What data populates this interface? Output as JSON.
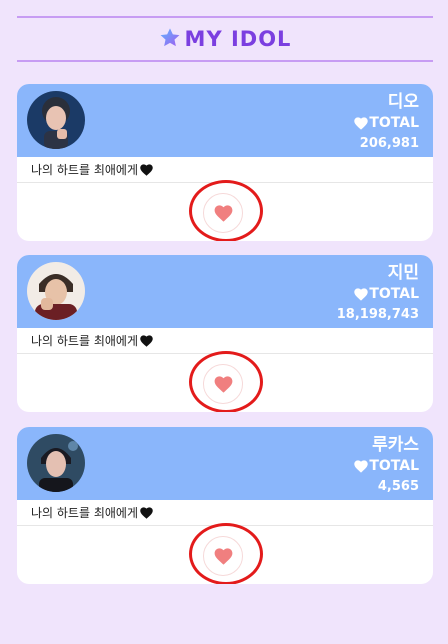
{
  "header": {
    "title": "MY IDOL",
    "star_icon": "star-icon"
  },
  "colors": {
    "background": "#f0e4fc",
    "header_line": "#c79cf3",
    "title": "#7b3fe0",
    "card_top": "#8ab6fb",
    "heart": "#f07f7f",
    "highlight_ring": "#e31b1b"
  },
  "cards": [
    {
      "name": "디오",
      "total_label": "TOTAL",
      "count": "206,981",
      "message": "나의 하트를 최애에게",
      "avatar_icon": "avatar-photo"
    },
    {
      "name": "지민",
      "total_label": "TOTAL",
      "count": "18,198,743",
      "message": "나의 하트를 최애에게",
      "avatar_icon": "avatar-photo"
    },
    {
      "name": "루카스",
      "total_label": "TOTAL",
      "count": "4,565",
      "message": "나의 하트를 최애에게",
      "avatar_icon": "avatar-photo"
    }
  ]
}
